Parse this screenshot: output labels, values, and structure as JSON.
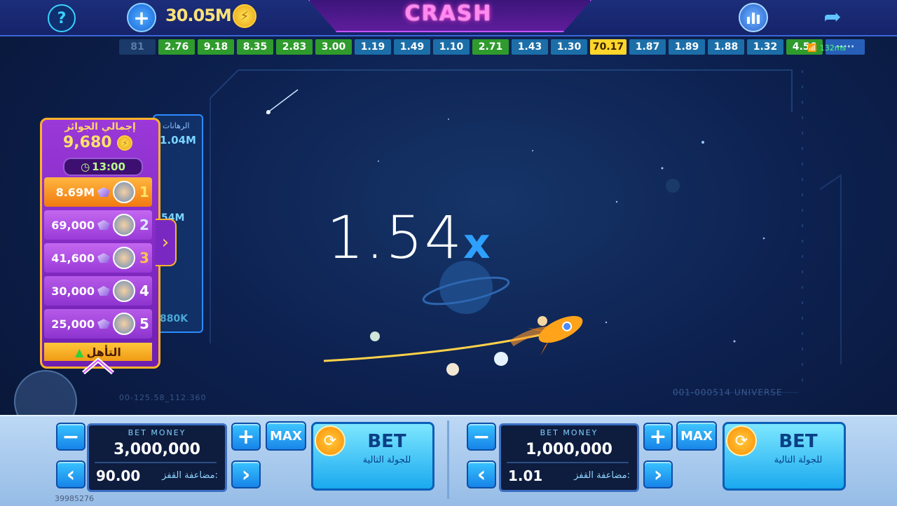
{
  "topbar": {
    "help_icon": "question-icon",
    "add_icon": "plus-icon",
    "balance": "30.05M",
    "game_title": "CRASH",
    "stats_icon": "bar-chart-icon",
    "share_icon": "share-arrow-icon"
  },
  "history": [
    {
      "value": "81",
      "type": "dim"
    },
    {
      "value": "2.76",
      "type": "green"
    },
    {
      "value": "9.18",
      "type": "green"
    },
    {
      "value": "8.35",
      "type": "green"
    },
    {
      "value": "2.83",
      "type": "green"
    },
    {
      "value": "3.00",
      "type": "green"
    },
    {
      "value": "1.19",
      "type": "blue"
    },
    {
      "value": "1.49",
      "type": "blue"
    },
    {
      "value": "1.10",
      "type": "blue"
    },
    {
      "value": "2.71",
      "type": "green"
    },
    {
      "value": "1.43",
      "type": "blue"
    },
    {
      "value": "1.30",
      "type": "blue"
    },
    {
      "value": "70.17",
      "type": "yellow"
    },
    {
      "value": "1.87",
      "type": "blue"
    },
    {
      "value": "1.89",
      "type": "blue"
    },
    {
      "value": "1.88",
      "type": "blue"
    },
    {
      "value": "1.32",
      "type": "blue"
    },
    {
      "value": "4.56",
      "type": "green"
    },
    {
      "value": "·····",
      "type": "more"
    }
  ],
  "ping": "132ms",
  "game": {
    "multiplier": "1.54",
    "multiplier_suffix": "x",
    "universe_label": "001-000514 UNIVERSE",
    "coords_label": "00-125.58_112.360"
  },
  "side_bets": {
    "header": "الرهانات",
    "total": "1.04M",
    "values": [
      "54M",
      "",
      "M",
      "880K"
    ]
  },
  "leaderboard": {
    "title": "إجمالي الجوائز",
    "total": "9,680",
    "timer": "13:00",
    "rows": [
      {
        "amount": "8.69M",
        "rank": "1"
      },
      {
        "amount": "69,000",
        "rank": "2"
      },
      {
        "amount": "41,600",
        "rank": "3"
      },
      {
        "amount": "30,000",
        "rank": "4"
      },
      {
        "amount": "25,000",
        "rank": "5"
      }
    ],
    "qualify_label": "التأهل"
  },
  "bet_panels": [
    {
      "label": "BET MONEY",
      "amount": "3,000,000",
      "payout": "90.00",
      "payout_label": "مضاعفة القفز:",
      "minus": "−",
      "plus": "+",
      "max": "MAX",
      "prev": "‹",
      "next": "›",
      "bet_label": "BET",
      "bet_sub": "للجولة التالية"
    },
    {
      "label": "BET MONEY",
      "amount": "1,000,000",
      "payout": "1.01",
      "payout_label": "مضاعفة القفز:",
      "minus": "−",
      "plus": "+",
      "max": "MAX",
      "prev": "‹",
      "next": "›",
      "bet_label": "BET",
      "bet_sub": "للجولة التالية"
    }
  ],
  "footer_id": "39985276",
  "colors": {
    "accent": "#2ea0ff",
    "green_chip": "#2f9b2d",
    "blue_chip": "#1c6ea8",
    "yellow_chip": "#ffd62a",
    "leader_purple": "#8a2fd0",
    "leader_gold": "#ffb12a"
  }
}
